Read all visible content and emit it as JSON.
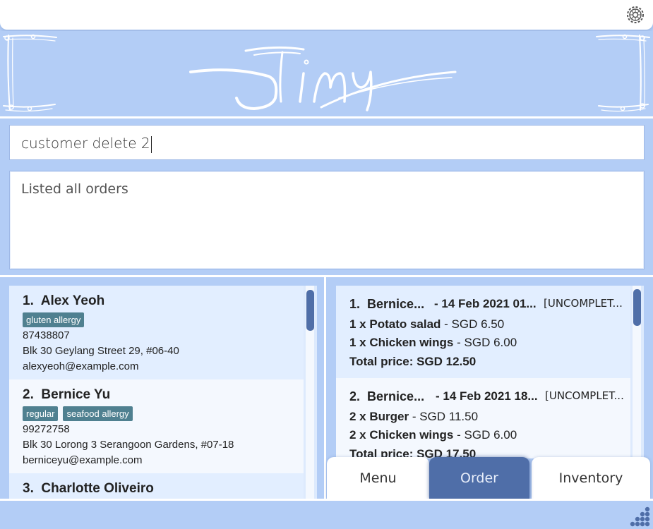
{
  "app": {
    "logo_text": "Jimy",
    "accent_color": "#4f6ea8",
    "tag_color": "#4f8090"
  },
  "command": {
    "value": "customer delete 2"
  },
  "result": {
    "text": "Listed all orders"
  },
  "customers": [
    {
      "index": "1.",
      "name": "Alex Yeoh",
      "tags": [
        "gluten allergy"
      ],
      "phone": "87438807",
      "address": "Blk 30 Geylang Street 29, #06-40",
      "email": "alexyeoh@example.com"
    },
    {
      "index": "2.",
      "name": "Bernice Yu",
      "tags": [
        "regular",
        "seafood allergy"
      ],
      "phone": "99272758",
      "address": "Blk 30 Lorong 3 Serangoon Gardens, #07-18",
      "email": "berniceyu@example.com"
    },
    {
      "index": "3.",
      "name": "Charlotte Oliveiro"
    }
  ],
  "orders": [
    {
      "index": "1.",
      "customer": "Bernice...",
      "date": "- 14 Feb 2021 01...",
      "status": "[UNCOMPLET...",
      "items": [
        {
          "qty": "1 x Potato salad",
          "price": "- SGD 6.50"
        },
        {
          "qty": "1 x Chicken wings",
          "price": "- SGD 6.00"
        }
      ],
      "total": "Total price: SGD 12.50"
    },
    {
      "index": "2.",
      "customer": "Bernice...",
      "date": "- 14 Feb 2021 18...",
      "status": "[UNCOMPLET...",
      "items": [
        {
          "qty": "2 x Burger",
          "price": "- SGD 11.50"
        },
        {
          "qty": "2 x Chicken wings",
          "price": "- SGD 6.00"
        }
      ],
      "total": "Total price: SGD 17.50"
    }
  ],
  "tabs": {
    "menu": "Menu",
    "order": "Order",
    "inventory": "Inventory",
    "active": "order"
  }
}
